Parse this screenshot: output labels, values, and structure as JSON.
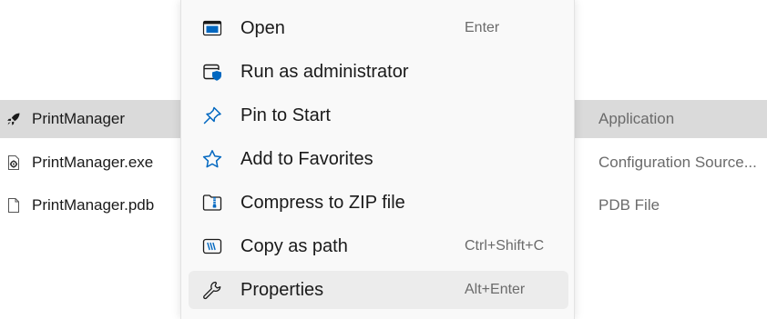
{
  "files": [
    {
      "name": "PrintManager",
      "type": "Application",
      "icon": "rocket-app-icon",
      "selected": true
    },
    {
      "name": "PrintManager.exe",
      "type": "Configuration Source...",
      "icon": "config-file-icon",
      "selected": false
    },
    {
      "name": "PrintManager.pdb",
      "type": "PDB File",
      "icon": "blank-file-icon",
      "selected": false
    }
  ],
  "context_menu": {
    "items": [
      {
        "label": "Open",
        "shortcut": "Enter",
        "icon": "open-window-icon"
      },
      {
        "label": "Run as administrator",
        "shortcut": "",
        "icon": "admin-shield-icon"
      },
      {
        "label": "Pin to Start",
        "shortcut": "",
        "icon": "pin-icon"
      },
      {
        "label": "Add to Favorites",
        "shortcut": "",
        "icon": "star-icon"
      },
      {
        "label": "Compress to ZIP file",
        "shortcut": "",
        "icon": "zip-folder-icon"
      },
      {
        "label": "Copy as path",
        "shortcut": "Ctrl+Shift+C",
        "icon": "copy-path-icon"
      },
      {
        "label": "Properties",
        "shortcut": "Alt+Enter",
        "icon": "wrench-icon",
        "highlighted": true
      }
    ]
  },
  "colors": {
    "accent": "#0067c0",
    "selection": "#dadada",
    "menu_background": "#f9f9f9",
    "menu_hover": "#ececec"
  }
}
